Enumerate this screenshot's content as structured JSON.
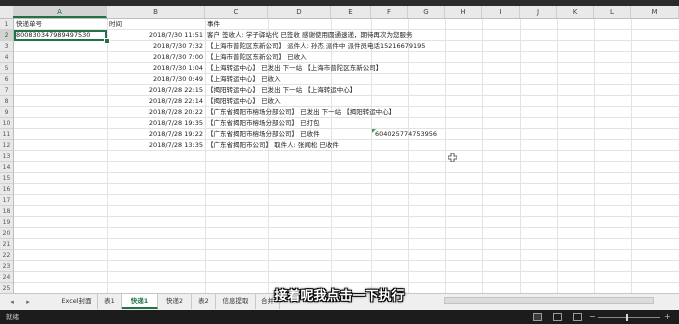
{
  "columns": [
    "A",
    "B",
    "C",
    "D",
    "E",
    "F",
    "G",
    "H",
    "I",
    "J",
    "K",
    "L",
    "M"
  ],
  "rows": [
    "1",
    "2",
    "3",
    "4",
    "5",
    "6",
    "7",
    "8",
    "9",
    "10",
    "11",
    "12",
    "13",
    "14",
    "15",
    "16",
    "17",
    "18",
    "19",
    "20",
    "21",
    "22",
    "23",
    "24",
    "25"
  ],
  "header_row": {
    "a": "快递单号",
    "b": "时间",
    "c": "事件"
  },
  "tracking_number": "800830347989497530",
  "events": [
    {
      "time": "2018/7/30 11:51",
      "event": "客户 签收人: 学子驿站代 已签收 感谢使用圆通速递，期待再次为您服务"
    },
    {
      "time": "2018/7/30 7:32",
      "event": "【上海市普陀区东新公司】 派件人: 孙杰 派件中 派件员电话15216679195"
    },
    {
      "time": "2018/7/30 7:00",
      "event": "【上海市普陀区东新公司】 已收入"
    },
    {
      "time": "2018/7/30 1:04",
      "event": "【上海转运中心】 已发出 下一站 【上海市普陀区东新公司】"
    },
    {
      "time": "2018/7/30 0:49",
      "event": "【上海转运中心】 已收入"
    },
    {
      "time": "2018/7/28 22:15",
      "event": "【揭阳转运中心】 已发出 下一站 【上海转运中心】"
    },
    {
      "time": "2018/7/28 22:14",
      "event": "【揭阳转运中心】 已收入"
    },
    {
      "time": "2018/7/28 20:22",
      "event": "【广东省揭阳市榕场分部公司】 已发出 下一站 【揭阳转运中心】"
    },
    {
      "time": "2018/7/28 19:35",
      "event": "【广东省揭阳市榕场分部公司】 已打包"
    },
    {
      "time": "2018/7/28 19:22",
      "event": "【广东省揭阳市榕场分部公司】 已收件"
    },
    {
      "time": "2018/7/28 13:35",
      "event": "【广东省揭阳市公司】 取件人: 张闻松 已收件"
    }
  ],
  "extra_value": "604025774753956",
  "tabs": {
    "t1": "Excel封面",
    "t2": "表1",
    "t3": "快递1",
    "t4": "快递2",
    "t5": "表2",
    "t6": "信息提取",
    "t7": "合并"
  },
  "status_text": "就绪",
  "subtitle": "接着呢我点击一下执行",
  "icons": [
    "prev-sheet-icon",
    "next-sheet-icon",
    "normal-view-icon",
    "page-layout-icon",
    "page-break-icon",
    "zoom-out-icon",
    "zoom-in-icon",
    "cell-cursor-icon"
  ],
  "colors": {
    "accent": "#217346",
    "tag": "#3f9a50"
  }
}
